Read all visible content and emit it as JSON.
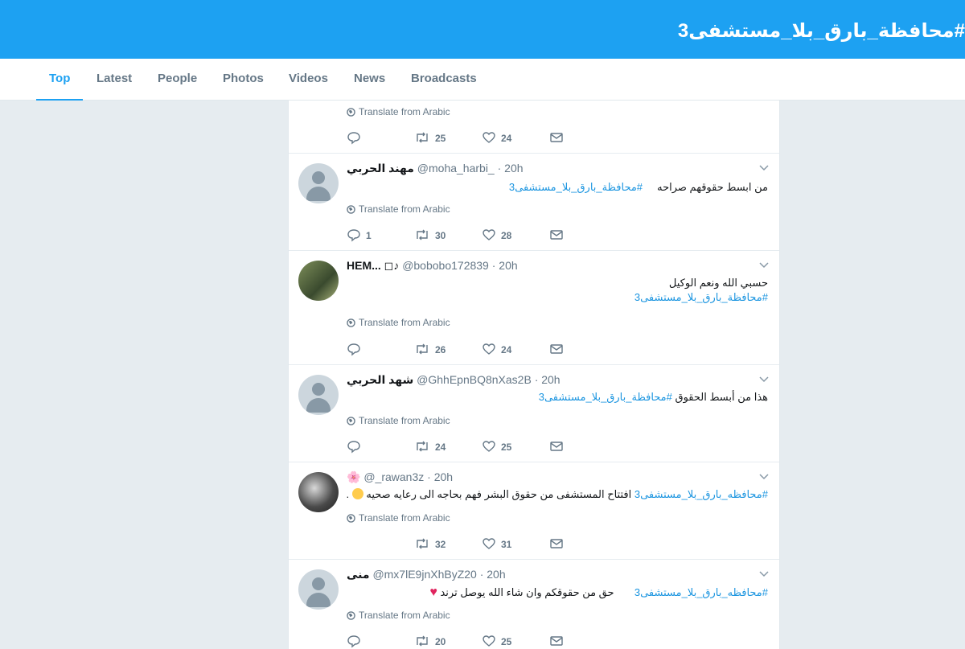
{
  "header": {
    "title": "#محافظة_بارق_بلا_مستشفى3"
  },
  "tabs": [
    {
      "label": "Top"
    },
    {
      "label": "Latest"
    },
    {
      "label": "People"
    },
    {
      "label": "Photos"
    },
    {
      "label": "Videos"
    },
    {
      "label": "News"
    },
    {
      "label": "Broadcasts"
    }
  ],
  "translate_label": "Translate from Arabic",
  "tweets": [
    {
      "translate": "Translate from Arabic",
      "reply": "",
      "retweet": "25",
      "like": "24"
    },
    {
      "name": "مهند الحربي",
      "handle": "@moha_harbi_",
      "time": "· 20h",
      "text": "من ابسط حقوقهم صراحه",
      "hashtag": "#محافظة_بارق_بلا_مستشفى3",
      "translate": "Translate from Arabic",
      "reply": "1",
      "retweet": "30",
      "like": "28"
    },
    {
      "name": "HEM... ◻♪",
      "handle": "@bobobo172839",
      "time": "· 20h",
      "text": "حسبي الله ونعم الوكيل",
      "hashtag": "#محافظة_بارق_بلا_مستشفى3",
      "translate": "Translate from Arabic",
      "reply": "",
      "retweet": "26",
      "like": "24"
    },
    {
      "name": "شهد الحربي",
      "handle": "@GhhEpnBQ8nXas2B",
      "time": "· 20h",
      "text": "هذا من أبسط الحقوق",
      "hashtag": "#محافظة_بارق_بلا_مستشفى3",
      "translate": "Translate from Arabic",
      "reply": "",
      "retweet": "24",
      "like": "25"
    },
    {
      "name": "🌸",
      "handle": "@_rawan3z",
      "time": "· 20h",
      "hashtag": "#محافظه_بارق_بلا_مستشفى3",
      "text": "افتتاح المستشفى من حقوق البشر فهم بحاجه الى رعايه صحيه",
      "translate": "Translate from Arabic",
      "reply": "",
      "retweet": "32",
      "like": "31"
    },
    {
      "name": "منى",
      "handle": "@mx7lE9jnXhByZ20",
      "time": "· 20h",
      "hashtag": "#محافظه_بارق_بلا_مستشفى3",
      "text": "حق من حقوقكم وان شاء الله يوصل ترند",
      "translate": "Translate from Arabic",
      "reply": "",
      "retweet": "20",
      "like": "25"
    }
  ],
  "colors": {
    "brand": "#1da1f2",
    "background": "#e6ecf0",
    "link": "#1b95e0",
    "muted": "#657786"
  }
}
